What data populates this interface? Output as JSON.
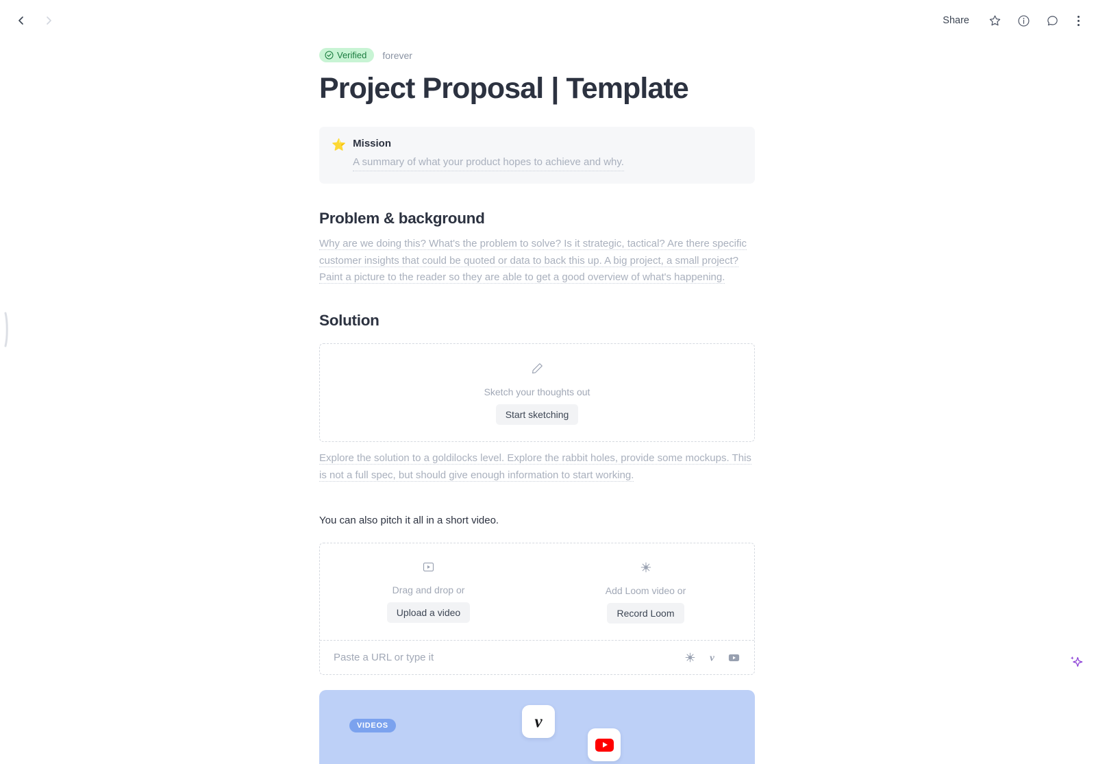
{
  "topbar": {
    "back_icon": "chevron-left-icon",
    "forward_icon": "chevron-right-icon",
    "share_label": "Share",
    "star_icon": "star-outline-icon",
    "info_icon": "info-circle-icon",
    "comment_icon": "comment-bubble-icon",
    "more_icon": "kebab-menu-icon"
  },
  "document": {
    "badge": {
      "verified_label": "Verified",
      "verified_icon": "check-circle-icon",
      "verified_bg": "#c8f4d4",
      "verified_fg": "#1a7c3e"
    },
    "expiry_label": "forever",
    "title": "Project Proposal | Template",
    "callout": {
      "emoji": "⭐",
      "emoji_name": "star-emoji",
      "heading": "Mission",
      "placeholder": "A summary of what your product hopes to achieve and why."
    },
    "sections": [
      {
        "heading": "Problem & background",
        "placeholder": "Why are we doing this? What's the problem to solve? Is it strategic, tactical? Are there specific customer insights that could be quoted or data to back this up. A big project, a small project? Paint a picture to the reader so they are able to get a good overview of what's happening."
      },
      {
        "heading": "Solution",
        "placeholder": "Explore the solution to a goldilocks level. Explore the rabbit holes, provide some mockups. This is not a full spec, but should give enough information to start working."
      }
    ],
    "sketch_zone": {
      "icon": "pencil-icon",
      "label": "Sketch your thoughts out",
      "button": "Start sketching"
    },
    "video_intro": "You can also pitch it all in a short video.",
    "video_zone": {
      "upload": {
        "icon": "video-play-box-icon",
        "label": "Drag and drop or",
        "button": "Upload a video"
      },
      "loom": {
        "icon": "loom-icon",
        "label": "Add Loom video or",
        "button": "Record Loom"
      },
      "url_placeholder": "Paste a URL or type it",
      "service_icons": [
        "loom-icon",
        "vimeo-icon",
        "youtube-icon"
      ]
    },
    "banner": {
      "badge": "VIDEOS",
      "bg_color": "#bdd0f7",
      "badge_color": "#7ba2ee",
      "tiles": [
        "vimeo-icon",
        "youtube-icon"
      ]
    }
  },
  "ai": {
    "icon": "sparkle-icon",
    "color": "#8b3fd6"
  },
  "sidebar": {
    "handle": "sidebar-resize-handle"
  }
}
